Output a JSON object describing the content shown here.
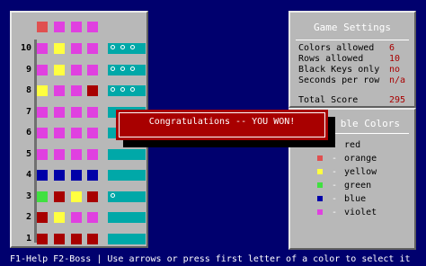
{
  "board": {
    "row_numbers": [
      "10",
      "9",
      "8",
      "7",
      "6",
      "5",
      "4",
      "3",
      "2",
      "1"
    ],
    "top_row": [
      "#e05050",
      "#e040e0",
      "#e040e0",
      "#e040e0"
    ],
    "rows": [
      {
        "pegs": [
          "#e040e0",
          "#ffff40",
          "#e040e0",
          "#e040e0"
        ],
        "feedback": 3
      },
      {
        "pegs": [
          "#e040e0",
          "#ffff40",
          "#e040e0",
          "#e040e0"
        ],
        "feedback": 3
      },
      {
        "pegs": [
          "#ffff40",
          "#e040e0",
          "#e040e0",
          "#a80000"
        ],
        "feedback": 3
      },
      {
        "pegs": [
          "#e040e0",
          "#e040e0",
          "#e040e0",
          "#e040e0"
        ],
        "feedback": 0
      },
      {
        "pegs": [
          "#e040e0",
          "#e040e0",
          "#e040e0",
          "#e040e0"
        ],
        "feedback": 0
      },
      {
        "pegs": [
          "#e040e0",
          "#e040e0",
          "#e040e0",
          "#e040e0"
        ],
        "feedback": 0
      },
      {
        "pegs": [
          "#0000a8",
          "#0000a8",
          "#0000a8",
          "#0000a8"
        ],
        "feedback": 0
      },
      {
        "pegs": [
          "#40e040",
          "#a80000",
          "#ffff40",
          "#a80000"
        ],
        "feedback": 1
      },
      {
        "pegs": [
          "#a80000",
          "#ffff40",
          "#e040e0",
          "#e040e0"
        ],
        "feedback": 0
      },
      {
        "pegs": [
          "#a80000",
          "#a80000",
          "#a80000",
          "#a80000"
        ],
        "feedback": 0
      }
    ]
  },
  "settings": {
    "title": "Game Settings",
    "rows": [
      {
        "label": "Colors allowed",
        "value": "6"
      },
      {
        "label": "Rows allowed",
        "value": "10"
      },
      {
        "label": "Black Keys only",
        "value": "no"
      },
      {
        "label": "Seconds per row",
        "value": "n/a"
      }
    ],
    "score_label": "Total Score",
    "score_value": "295"
  },
  "colors_panel": {
    "title_visible": "ble Colors",
    "items": [
      {
        "swatch": "#a80000",
        "dash": "-",
        "label": "red"
      },
      {
        "swatch": "#e05050",
        "dash": "-",
        "label": "orange"
      },
      {
        "swatch": "#ffff40",
        "dash": "-",
        "label": "yellow"
      },
      {
        "swatch": "#40e040",
        "dash": "-",
        "label": "green"
      },
      {
        "swatch": "#0000a8",
        "dash": "-",
        "label": "blue"
      },
      {
        "swatch": "#e040e0",
        "dash": "-",
        "label": "violet"
      }
    ]
  },
  "dialog": {
    "message": "Congratulations -- YOU WON!"
  },
  "statusbar": {
    "text": "F1-Help  F2-Boss | Use arrows or press first letter of a color to select it"
  }
}
